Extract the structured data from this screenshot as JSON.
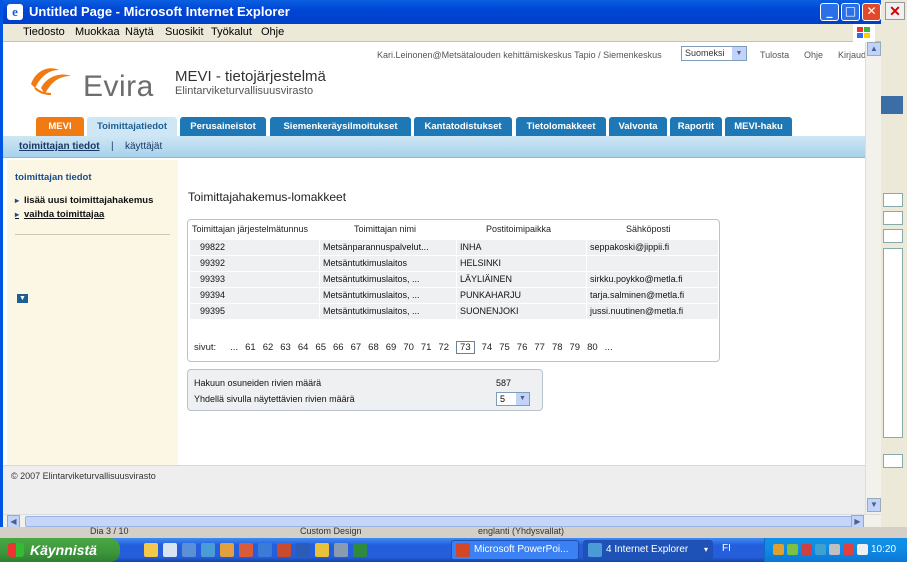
{
  "window": {
    "title": "Untitled Page - Microsoft Internet Explorer",
    "menu": [
      "Tiedosto",
      "Muokkaa",
      "Näytä",
      "Suosikit",
      "Työkalut",
      "Ohje"
    ]
  },
  "header": {
    "user": "Kari.Leinonen@Metsätalouden kehittämiskeskus Tapio / Siemenkeskus",
    "language": "Suomeksi",
    "links": [
      "Tulosta",
      "Ohje",
      "Kirjaud"
    ],
    "logo_text": "Evira",
    "app_title": "MEVI - tietojärjestelmä",
    "app_subtitle": "Elintarviketurvallisuusvirasto"
  },
  "tabs": [
    "MEVI",
    "Toimittajatiedot",
    "Perusaineistot",
    "Siemenkeräysilmoitukset",
    "Kantatodistukset",
    "Tietolomakkeet",
    "Valvonta",
    "Raportit",
    "MEVI-haku"
  ],
  "subnav": [
    "toimittajan tiedot",
    "|",
    "käyttäjät"
  ],
  "sidebar": {
    "heading": "toimittajan tiedot",
    "items": [
      "lisää uusi toimittajahakemus",
      "vaihda toimittajaa"
    ]
  },
  "main": {
    "title": "Toimittajahakemus-lomakkeet",
    "columns": [
      "Toimittajan järjestelmätunnus",
      "Toimittajan nimi",
      "Postitoimipaikka",
      "Sähköposti"
    ],
    "rows": [
      [
        "99822",
        "Metsänparannuspalvelut...",
        "INHA",
        "seppakoski@jippii.fi"
      ],
      [
        "99392",
        "Metsäntutkimuslaitos",
        "HELSINKI",
        ""
      ],
      [
        "99393",
        "Metsäntutkimuslaitos, ...",
        "LÄYLIÄINEN",
        "sirkku.poykko@metla.fi"
      ],
      [
        "99394",
        "Metsäntutkimuslaitos, ...",
        "PUNKAHARJU",
        "tarja.salminen@metla.fi"
      ],
      [
        "99395",
        "Metsäntutkimuslaitos, ...",
        "SUONENJOKI",
        "jussi.nuutinen@metla.fi"
      ]
    ],
    "pager": {
      "label": "sivut:",
      "pages": [
        "...",
        "61",
        "62",
        "63",
        "64",
        "65",
        "66",
        "67",
        "68",
        "69",
        "70",
        "71",
        "72",
        "73",
        "74",
        "75",
        "76",
        "77",
        "78",
        "79",
        "80",
        "..."
      ],
      "current": "73"
    },
    "info": {
      "count_label": "Hakuun osuneiden rivien määrä",
      "count_value": "587",
      "rows_label": "Yhdellä sivulla näytettävien rivien määrä",
      "rows_value": "5"
    }
  },
  "footer": "© 2007 Elintarviketurvallisuusvirasto",
  "behind": [
    "Dia 3 / 10",
    "Custom Design",
    "englanti (Yhdysvallat)"
  ],
  "taskbar": {
    "start": "Käynnistä",
    "tasks": [
      "Microsoft PowerPoi...",
      "4 Internet Explorer"
    ],
    "lang": "FI",
    "clock": "10:20"
  },
  "colors": {
    "tab_blue": "#1d78b5",
    "tab_orange": "#f07b12",
    "evira_orange": "#f07b12"
  }
}
